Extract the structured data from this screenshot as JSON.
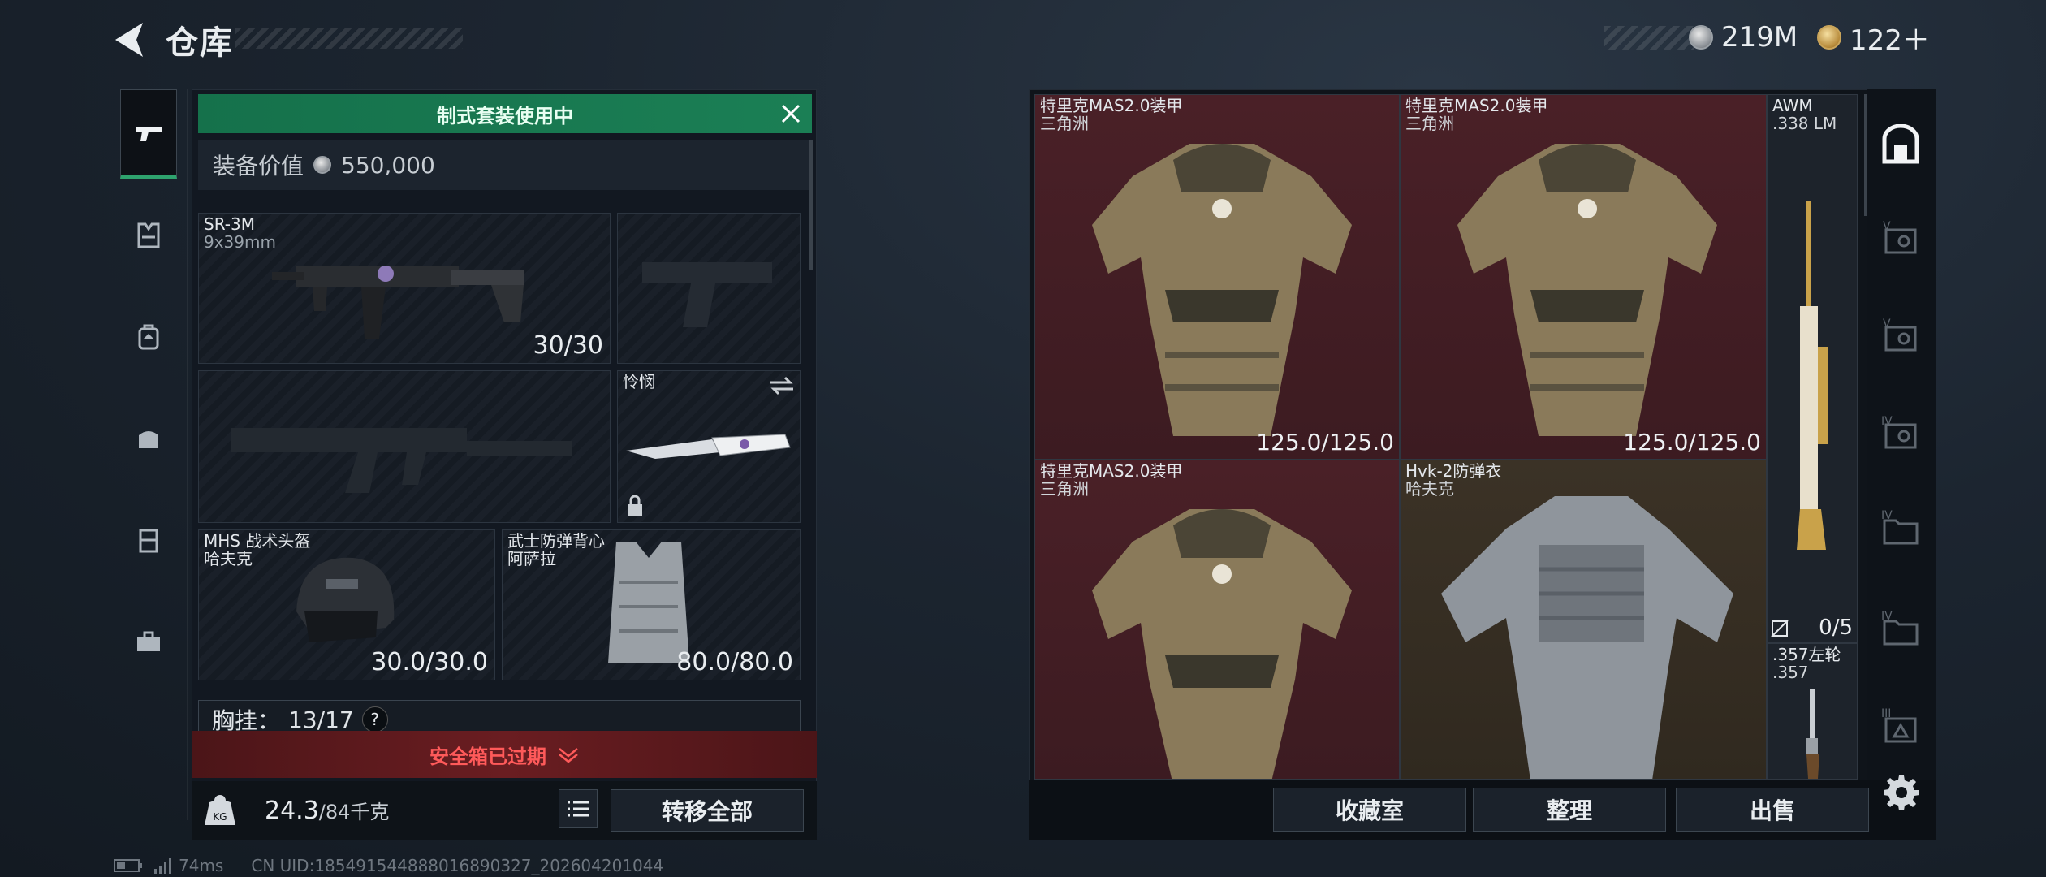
{
  "header": {
    "title": "仓库",
    "currency_silver": "219M",
    "currency_gold": "122＋"
  },
  "loadout": {
    "banner": "制式套装使用中",
    "value_label": "装备价值",
    "value": "550,000",
    "primary_weapon": {
      "name": "SR-3M",
      "ammo": "9x39mm",
      "durability": "30/30"
    },
    "melee": {
      "name": "怜悯"
    },
    "helmet": {
      "name": "MHS 战术头盔",
      "maker": "哈夫克",
      "durability": "30.0/30.0"
    },
    "armor": {
      "name": "武士防弹背心",
      "maker": "阿萨拉",
      "durability": "80.0/80.0"
    },
    "chest_rig": {
      "label": "胸挂：",
      "value": "13/17",
      "help": "?"
    },
    "safe_box": "安全箱已过期",
    "weight": "24.3",
    "weight_max": "/84千克",
    "transfer_all": "转移全部"
  },
  "storage": {
    "items": [
      {
        "name": "特里克MAS2.0装甲",
        "maker": "三角洲",
        "durability": "125.0/125.0"
      },
      {
        "name": "特里克MAS2.0装甲",
        "maker": "三角洲",
        "durability": "125.0/125.0"
      },
      {
        "name": "AWM",
        "maker": ".338 LM"
      },
      {
        "name": "特里克MAS2.0装甲",
        "maker": "三角洲"
      },
      {
        "name": "Hvk-2防弹衣",
        "maker": "哈夫克"
      },
      {
        "name": ".357左轮",
        "maker": ".357",
        "count": "0/5"
      }
    ],
    "actions": {
      "collection": "收藏室",
      "sort": "整理",
      "sell": "出售"
    },
    "tab_numerals": [
      "V",
      "V",
      "IV",
      "IV",
      "IV",
      "III"
    ]
  },
  "status": {
    "ping": "74ms",
    "uid": "CN UID:18549154488801689032​7_202604201044"
  },
  "colors": {
    "banner_green": "#1b7f55",
    "safe_red": "#ff5a5a",
    "cell_red": "#4a2027",
    "cell_brown": "#3b3226"
  }
}
